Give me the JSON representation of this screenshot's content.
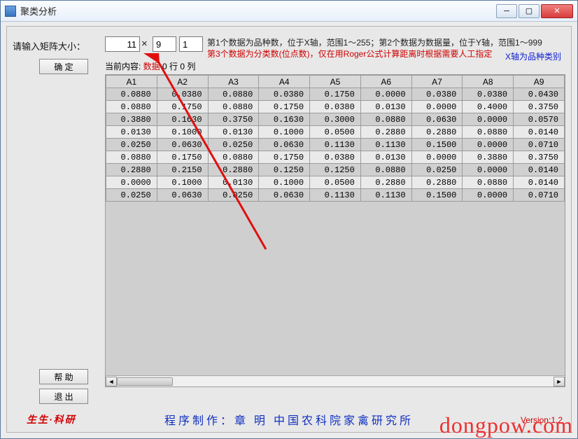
{
  "window": {
    "title": "聚类分析"
  },
  "inputs": {
    "label": "请输入矩阵大小：",
    "n1": "11",
    "times": "×",
    "n2": "9",
    "n3": "1"
  },
  "hints": {
    "line1": "第1个数据为品种数，位于X轴，范围1～255；第2个数据为数据量，位于Y轴，范围1～999",
    "line2": "第3个数据为分类数(位点数)，仅在用Roger公式计算距离时根据需要人工指定",
    "line3": "X轴为品种类别"
  },
  "buttons": {
    "ok": "确   定",
    "help": "帮   助",
    "exit": "退   出"
  },
  "current": {
    "prefix": "当前内容: ",
    "data": "数据",
    "row": "   0  行 0  列"
  },
  "table": {
    "headers": [
      "A1",
      "A2",
      "A3",
      "A4",
      "A5",
      "A6",
      "A7",
      "A8",
      "A9"
    ],
    "rows": [
      [
        "0.0880",
        "0.0380",
        "0.0880",
        "0.0380",
        "0.1750",
        "0.0000",
        "0.0380",
        "0.0380",
        "0.0430"
      ],
      [
        "0.0880",
        "0.1750",
        "0.0880",
        "0.1750",
        "0.0380",
        "0.0130",
        "0.0000",
        "0.4000",
        "0.3750"
      ],
      [
        "0.3880",
        "0.1630",
        "0.3750",
        "0.1630",
        "0.3000",
        "0.0880",
        "0.0630",
        "0.0000",
        "0.0570"
      ],
      [
        "0.0130",
        "0.1000",
        "0.0130",
        "0.1000",
        "0.0500",
        "0.2880",
        "0.2880",
        "0.0880",
        "0.0140"
      ],
      [
        "0.0250",
        "0.0630",
        "0.0250",
        "0.0630",
        "0.1130",
        "0.1130",
        "0.1500",
        "0.0000",
        "0.0710"
      ],
      [
        "0.0880",
        "0.1750",
        "0.0880",
        "0.1750",
        "0.0380",
        "0.0130",
        "0.0000",
        "0.3880",
        "0.3750"
      ],
      [
        "0.2880",
        "0.2150",
        "0.2880",
        "0.1250",
        "0.1250",
        "0.0880",
        "0.0250",
        "0.0000",
        "0.0140"
      ],
      [
        "0.0000",
        "0.1000",
        "0.0130",
        "0.1000",
        "0.0500",
        "0.2880",
        "0.2880",
        "0.0880",
        "0.0140"
      ],
      [
        "0.0250",
        "0.0630",
        "0.0250",
        "0.0630",
        "0.1130",
        "0.1130",
        "0.1500",
        "0.0000",
        "0.0710"
      ]
    ]
  },
  "footer": {
    "logo": "生生·科研",
    "credits": "程序制作：章 明   中国农科院家禽研究所",
    "version": "Version:1.2",
    "watermark": "dongpow.com"
  }
}
